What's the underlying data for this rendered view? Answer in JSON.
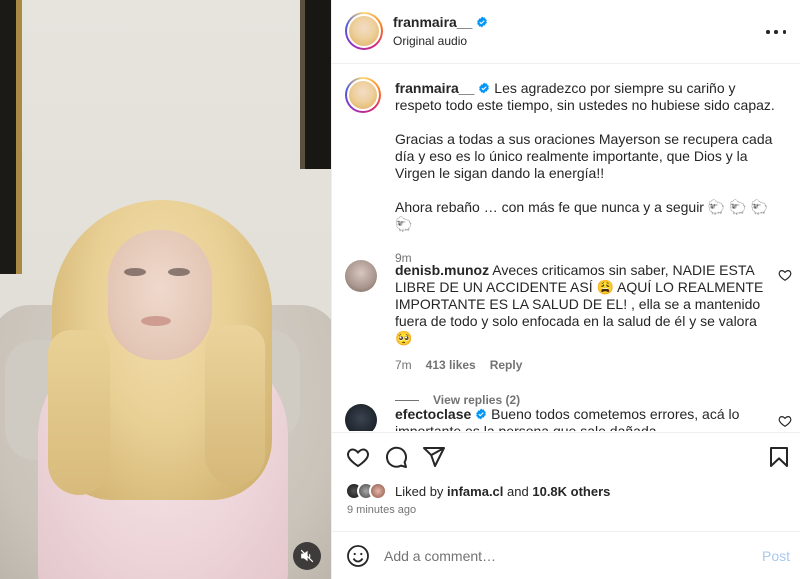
{
  "video": {
    "muted": true,
    "mute_icon": "speaker-muted-icon"
  },
  "header": {
    "username": "franmaira__",
    "verified": true,
    "audio": "Original audio",
    "more_icon": "more-dots-icon"
  },
  "caption": {
    "username": "franmaira__",
    "paragraphs": [
      "Les agradezco por siempre su cariño y respeto todo este tiempo, sin ustedes no hubiese sido capaz.",
      "Gracias a todas a sus oraciones Mayerson se recupera cada día y eso es lo único realmente importante, que Dios y la Virgen le sigan dando la energía!!",
      "Ahora rebaño … con más fe que nunca y a seguir 🐑 🐑 🐑 🐑"
    ],
    "time": "9m"
  },
  "comments": [
    {
      "username": "denisb.munoz",
      "verified": false,
      "text": "Aveces criticamos sin saber, NADIE ESTA LIBRE DE UN ACCIDENTE ASÍ 😩  AQUÍ LO REALMENTE IMPORTANTE ES LA SALUD DE EL! , ella se a mantenido fuera de todo y solo enfocada en la salud de él y se valora🥺",
      "time": "7m",
      "likes": "413 likes",
      "reply_label": "Reply",
      "view_replies": "View replies (2)"
    },
    {
      "username": "efectoclase",
      "verified": true,
      "text": "Bueno todos cometemos errores, acá lo importante es la persona que sale dañada"
    }
  ],
  "actions": {
    "like_icon": "heart-icon",
    "comment_icon": "comment-icon",
    "share_icon": "share-icon",
    "save_icon": "bookmark-icon"
  },
  "likes": {
    "prefix": "Liked by",
    "user": "infama.cl",
    "joiner": "and",
    "others": "10.8K others"
  },
  "posted_ago": "9 minutes ago",
  "add_comment": {
    "placeholder": "Add a comment…",
    "post_label": "Post",
    "emoji_icon": "emoji-smile-icon"
  },
  "colors": {
    "verified_blue": "#0095f6",
    "post_button_disabled": "#a8c8f0",
    "secondary_text": "#737373"
  }
}
